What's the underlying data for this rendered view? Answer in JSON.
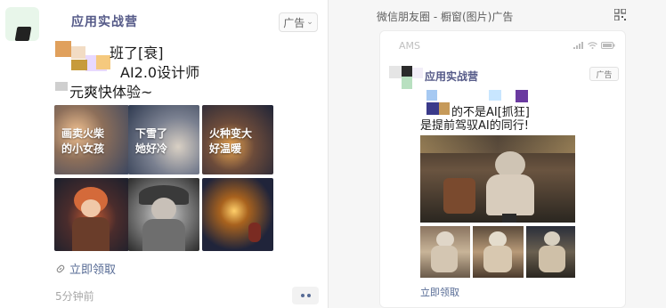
{
  "left_post": {
    "brand_name": "应用实战营",
    "ad_label": "广告",
    "line1": "班了[衰]",
    "line2": "AI2.0设计师",
    "line3": "元爽快体验~",
    "tiles": [
      {
        "label": "画卖火柴\n的小女孩"
      },
      {
        "label": "下雪了\n她好冷"
      },
      {
        "label": "火种变大\n好温暖"
      },
      {
        "label": ""
      },
      {
        "label": ""
      },
      {
        "label": ""
      }
    ],
    "link_text": "立即领取",
    "time_text": "5分钟前"
  },
  "right_panel": {
    "title": "微信朋友圈 - 橱窗(图片)广告",
    "status_text": "AMS",
    "brand_name": "应用实战营",
    "ad_label": "广告",
    "line1": "的不是AI[抓狂]",
    "line2": "是提前驾驭AI的同行!",
    "link_text": "立即领取"
  },
  "colors": {
    "link": "#576b95",
    "brand": "#555a88",
    "divider": "#e6e6e6",
    "right_bg": "#f6f6f6"
  },
  "icons": [
    "link-icon",
    "chevron-down-icon",
    "more-dots-icon",
    "qr-code-icon",
    "signal-icon",
    "wifi-icon",
    "battery-icon"
  ]
}
